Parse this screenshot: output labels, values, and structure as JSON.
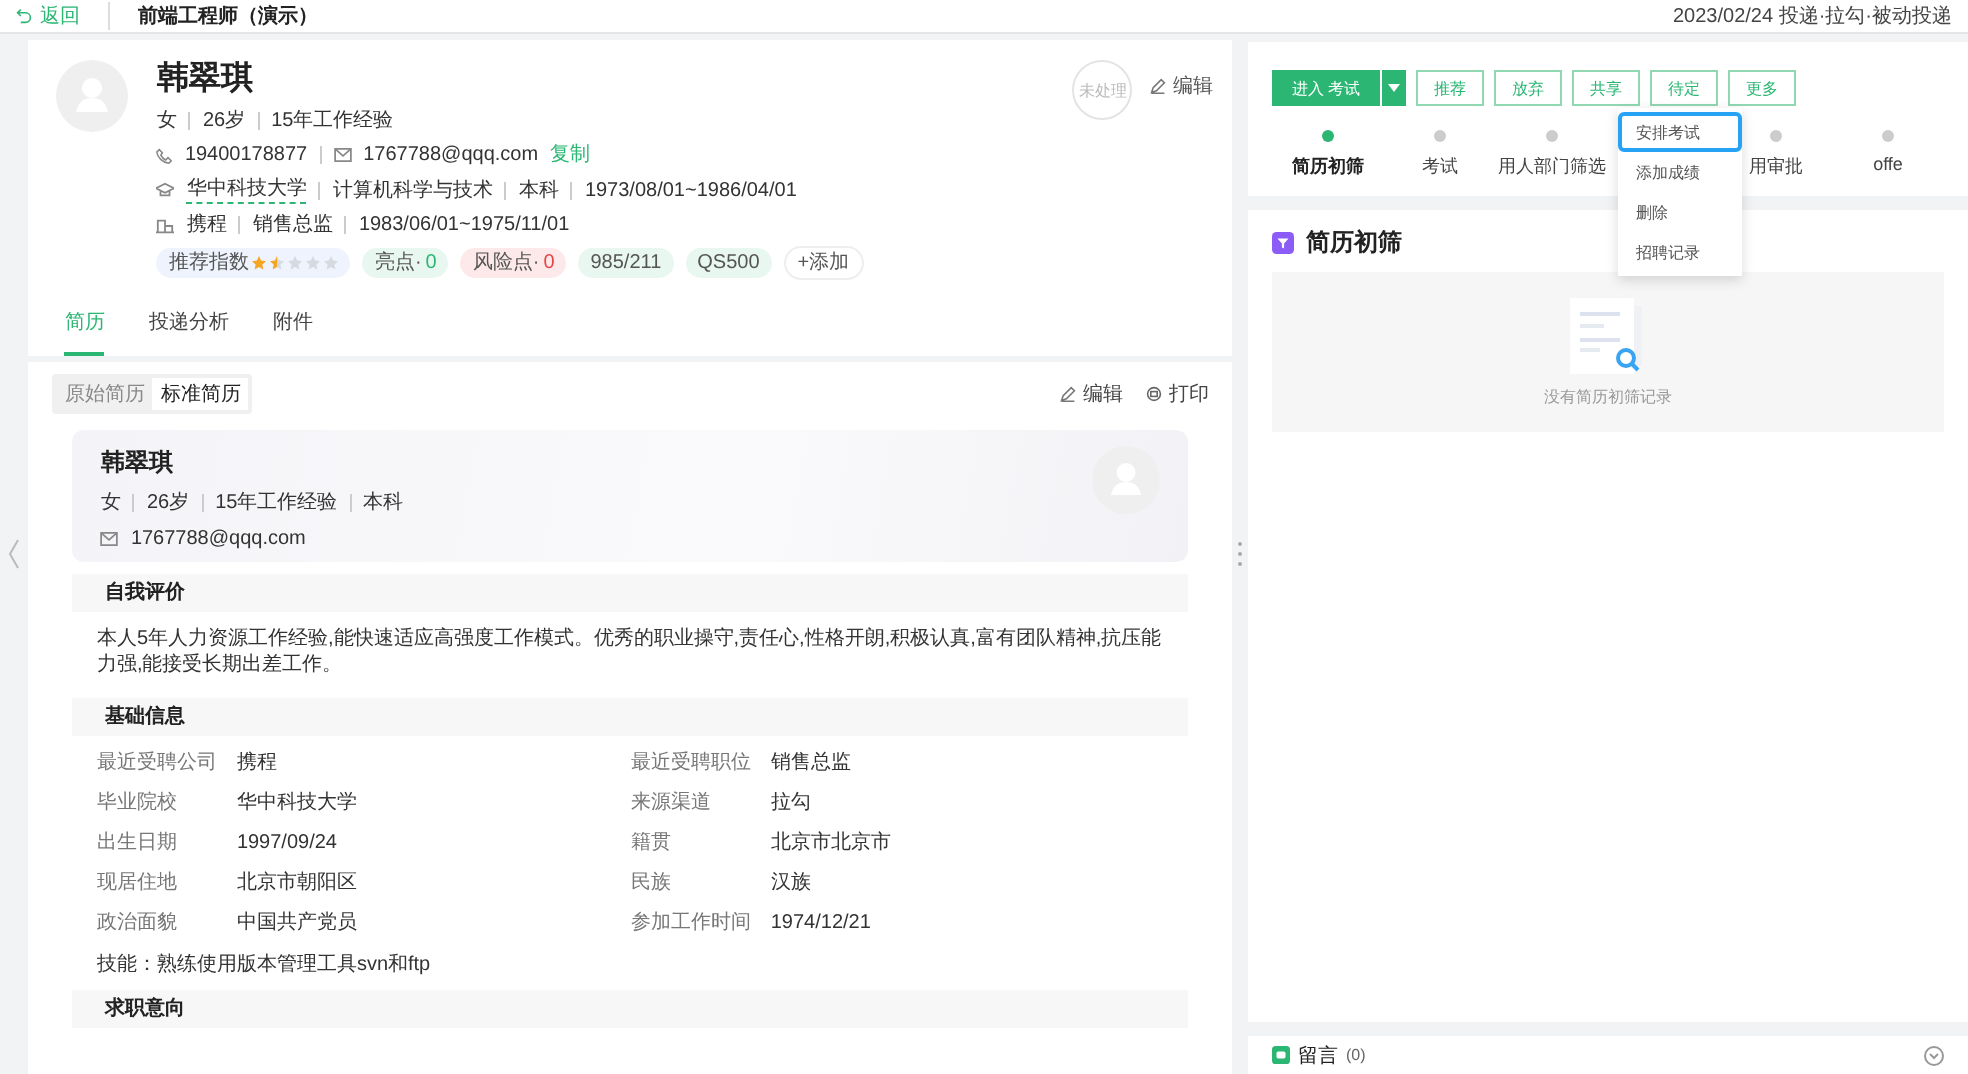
{
  "topbar": {
    "back": "返回",
    "title": "前端工程师（演示）",
    "meta": "2023/02/24 投递·拉勾·被动投递"
  },
  "candidate": {
    "name": "韩翠琪",
    "stamp": "未处理",
    "edit": "编辑",
    "basics": [
      "女",
      "26岁",
      "15年工作经验"
    ],
    "phone": "19400178877",
    "email": "1767788@qqq.com",
    "copy": "复制",
    "education": [
      "华中科技大学",
      "计算机科学与技术",
      "本科",
      "1973/08/01~1986/04/01"
    ],
    "work": [
      "携程",
      "销售总监",
      "1983/06/01~1975/11/01"
    ],
    "tags": [
      {
        "kind": "stars",
        "label": "推荐指数",
        "stars": 1.5,
        "color": "#eef3fd"
      },
      {
        "kind": "count",
        "label": "亮点·",
        "count": "0",
        "color": "#e8f7ef"
      },
      {
        "kind": "count",
        "label": "风险点·",
        "count": "0",
        "color": "#fde9e9"
      },
      {
        "kind": "plain",
        "label": "985/211",
        "color": "#e8f7ef"
      },
      {
        "kind": "plain",
        "label": "QS500",
        "color": "#e8f7ef"
      },
      {
        "kind": "add",
        "label": "+添加",
        "color": "#ffffff"
      }
    ]
  },
  "tabs": [
    {
      "label": "简历",
      "selected": true
    },
    {
      "label": "投递分析",
      "selected": false
    },
    {
      "label": "附件",
      "selected": false
    }
  ],
  "resume": {
    "views": [
      {
        "label": "原始简历",
        "selected": false
      },
      {
        "label": "标准简历",
        "selected": true
      }
    ],
    "edit": "编辑",
    "print": "打印",
    "card": {
      "name": "韩翠琪",
      "basics": [
        "女",
        "26岁",
        "15年工作经验",
        "本科"
      ],
      "email": "1767788@qqq.com"
    },
    "sections": [
      {
        "title": "自我评价",
        "kind": "text",
        "text": "本人5年人力资源工作经验,能快速适应高强度工作模式。优秀的职业操守,责任心,性格开朗,积极认真,富有团队精神,抗压能力强,能接受长期出差工作。"
      },
      {
        "title": "基础信息",
        "kind": "fields",
        "fields": [
          {
            "label": "最近受聘公司",
            "value": "携程"
          },
          {
            "label": "最近受聘职位",
            "value": "销售总监"
          },
          {
            "label": "毕业院校",
            "value": "华中科技大学"
          },
          {
            "label": "来源渠道",
            "value": "拉勾"
          },
          {
            "label": "出生日期",
            "value": "1997/09/24"
          },
          {
            "label": "籍贯",
            "value": "北京市北京市"
          },
          {
            "label": "现居住地",
            "value": "北京市朝阳区"
          },
          {
            "label": "民族",
            "value": "汉族"
          },
          {
            "label": "政治面貌",
            "value": "中国共产党员"
          },
          {
            "label": "参加工作时间",
            "value": "1974/12/21"
          }
        ],
        "note": "技能：熟练使用版本管理工具svn和ftp"
      },
      {
        "title": "求职意向",
        "kind": "empty"
      }
    ]
  },
  "actions": {
    "primary": "进入 考试",
    "buttons": [
      "推荐",
      "放弃",
      "共享",
      "待定",
      "更多"
    ],
    "menu": [
      {
        "label": "安排考试",
        "selected": true
      },
      {
        "label": "添加成绩",
        "selected": false
      },
      {
        "label": "删除",
        "selected": false
      },
      {
        "label": "招聘记录",
        "selected": false
      }
    ]
  },
  "steps": [
    {
      "label": "简历初筛",
      "selected": true
    },
    {
      "label": "考试",
      "selected": false
    },
    {
      "label": "用人部门筛选",
      "selected": false
    },
    {
      "label": "用审批",
      "selected": false
    },
    {
      "label": "offe",
      "selected": false
    }
  ],
  "screening": {
    "title": "简历初筛",
    "empty": "没有简历初筛记录"
  },
  "comments": {
    "title": "留言",
    "count": "(0)"
  }
}
